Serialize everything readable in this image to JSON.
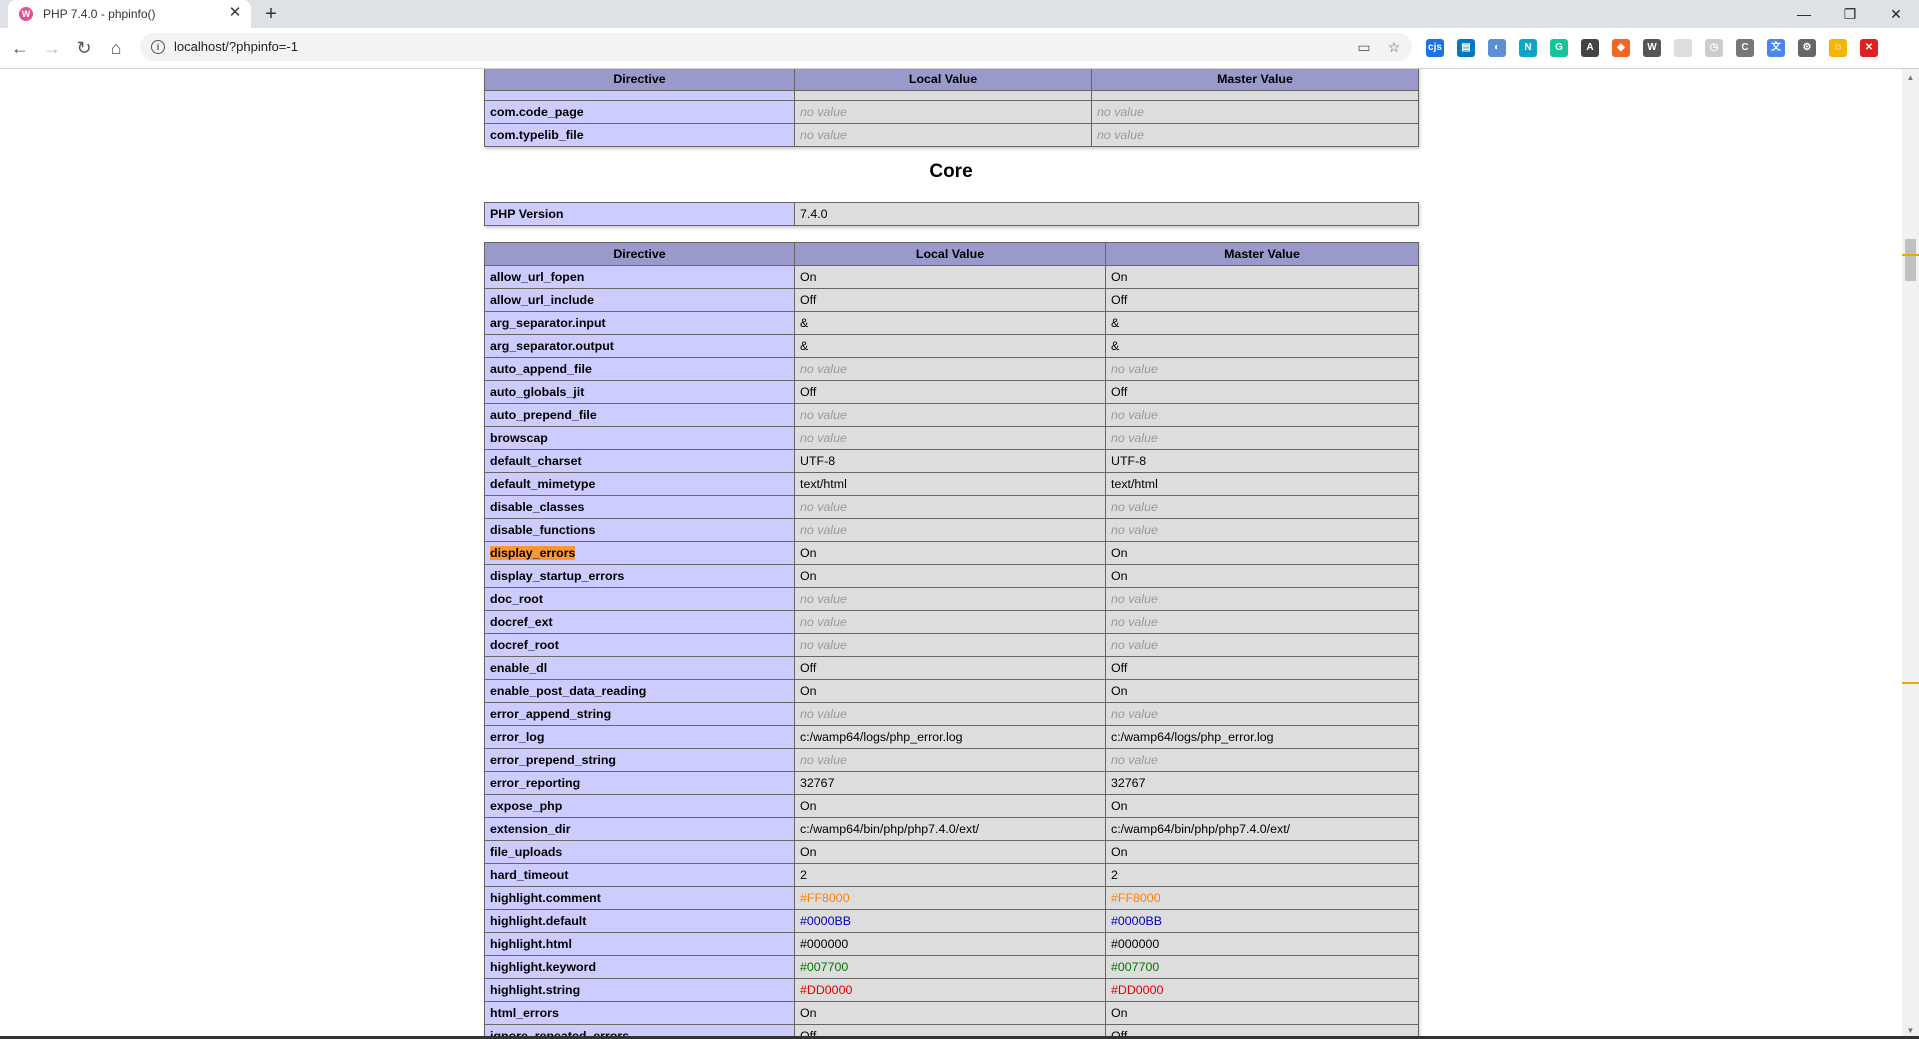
{
  "browser": {
    "tab_title": "PHP 7.4.0 - phpinfo()",
    "tab_favicon": "wamp-icon",
    "url": "localhost/?phpinfo=-1"
  },
  "extensions": [
    {
      "icon": "cjs-icon",
      "label": "cjs",
      "color": "#1a73e8"
    },
    {
      "icon": "trello-icon",
      "label": "▤",
      "color": "#0079bf"
    },
    {
      "icon": "edge-icon",
      "label": "◐",
      "color": "#5b8fd6"
    },
    {
      "icon": "notion-icon",
      "label": "N",
      "color": "#12a3c4"
    },
    {
      "icon": "grammarly-icon",
      "label": "G",
      "color": "#15c39a"
    },
    {
      "icon": "angular-icon",
      "label": "A",
      "color": "#444444"
    },
    {
      "icon": "sync-icon",
      "label": "◆",
      "color": "#f26522"
    },
    {
      "icon": "wordpress-icon",
      "label": "W",
      "color": "#555555"
    },
    {
      "icon": "blank-ext-icon",
      "label": "",
      "color": "#dddddd"
    },
    {
      "icon": "clock-ext-icon",
      "label": "◷",
      "color": "#cccccc"
    },
    {
      "icon": "code-ext-icon",
      "label": "C",
      "color": "#777777"
    },
    {
      "icon": "translate-icon",
      "label": "文",
      "color": "#4a86e8"
    },
    {
      "icon": "settings-ext-icon",
      "label": "⚙",
      "color": "#666666"
    },
    {
      "icon": "emoji-ext-icon",
      "label": "☺",
      "color": "#f4b400"
    },
    {
      "icon": "stop-ext-icon",
      "label": "✕",
      "color": "#e02020"
    }
  ],
  "com_table": {
    "headers": [
      "Directive",
      "Local Value",
      "Master Value"
    ],
    "rows": [
      {
        "name": "com.code_page",
        "local": "no value",
        "master": "no value",
        "nv": true
      },
      {
        "name": "com.typelib_file",
        "local": "no value",
        "master": "no value",
        "nv": true
      }
    ]
  },
  "core": {
    "title": "Core",
    "version_label": "PHP Version",
    "version_value": "7.4.0",
    "headers": [
      "Directive",
      "Local Value",
      "Master Value"
    ],
    "rows": [
      {
        "name": "allow_url_fopen",
        "local": "On",
        "master": "On"
      },
      {
        "name": "allow_url_include",
        "local": "Off",
        "master": "Off"
      },
      {
        "name": "arg_separator.input",
        "local": "&",
        "master": "&"
      },
      {
        "name": "arg_separator.output",
        "local": "&",
        "master": "&"
      },
      {
        "name": "auto_append_file",
        "local": "no value",
        "master": "no value",
        "nv": true
      },
      {
        "name": "auto_globals_jit",
        "local": "Off",
        "master": "Off"
      },
      {
        "name": "auto_prepend_file",
        "local": "no value",
        "master": "no value",
        "nv": true
      },
      {
        "name": "browscap",
        "local": "no value",
        "master": "no value",
        "nv": true
      },
      {
        "name": "default_charset",
        "local": "UTF-8",
        "master": "UTF-8"
      },
      {
        "name": "default_mimetype",
        "local": "text/html",
        "master": "text/html"
      },
      {
        "name": "disable_classes",
        "local": "no value",
        "master": "no value",
        "nv": true
      },
      {
        "name": "disable_functions",
        "local": "no value",
        "master": "no value",
        "nv": true
      },
      {
        "name": "display_errors",
        "local": "On",
        "master": "On",
        "highlight": true
      },
      {
        "name": "display_startup_errors",
        "local": "On",
        "master": "On"
      },
      {
        "name": "doc_root",
        "local": "no value",
        "master": "no value",
        "nv": true
      },
      {
        "name": "docref_ext",
        "local": "no value",
        "master": "no value",
        "nv": true
      },
      {
        "name": "docref_root",
        "local": "no value",
        "master": "no value",
        "nv": true
      },
      {
        "name": "enable_dl",
        "local": "Off",
        "master": "Off"
      },
      {
        "name": "enable_post_data_reading",
        "local": "On",
        "master": "On"
      },
      {
        "name": "error_append_string",
        "local": "no value",
        "master": "no value",
        "nv": true
      },
      {
        "name": "error_log",
        "local": "c:/wamp64/logs/php_error.log",
        "master": "c:/wamp64/logs/php_error.log"
      },
      {
        "name": "error_prepend_string",
        "local": "no value",
        "master": "no value",
        "nv": true
      },
      {
        "name": "error_reporting",
        "local": "32767",
        "master": "32767"
      },
      {
        "name": "expose_php",
        "local": "On",
        "master": "On"
      },
      {
        "name": "extension_dir",
        "local": "c:/wamp64/bin/php/php7.4.0/ext/",
        "master": "c:/wamp64/bin/php/php7.4.0/ext/"
      },
      {
        "name": "file_uploads",
        "local": "On",
        "master": "On"
      },
      {
        "name": "hard_timeout",
        "local": "2",
        "master": "2"
      },
      {
        "name": "highlight.comment",
        "local": "#FF8000",
        "master": "#FF8000",
        "color": "#FF8000"
      },
      {
        "name": "highlight.default",
        "local": "#0000BB",
        "master": "#0000BB",
        "color": "#0000BB"
      },
      {
        "name": "highlight.html",
        "local": "#000000",
        "master": "#000000",
        "color": "#000000"
      },
      {
        "name": "highlight.keyword",
        "local": "#007700",
        "master": "#007700",
        "color": "#007700"
      },
      {
        "name": "highlight.string",
        "local": "#DD0000",
        "master": "#DD0000",
        "color": "#DD0000"
      },
      {
        "name": "html_errors",
        "local": "On",
        "master": "On"
      },
      {
        "name": "ignore_repeated_errors",
        "local": "Off",
        "master": "Off"
      }
    ]
  }
}
